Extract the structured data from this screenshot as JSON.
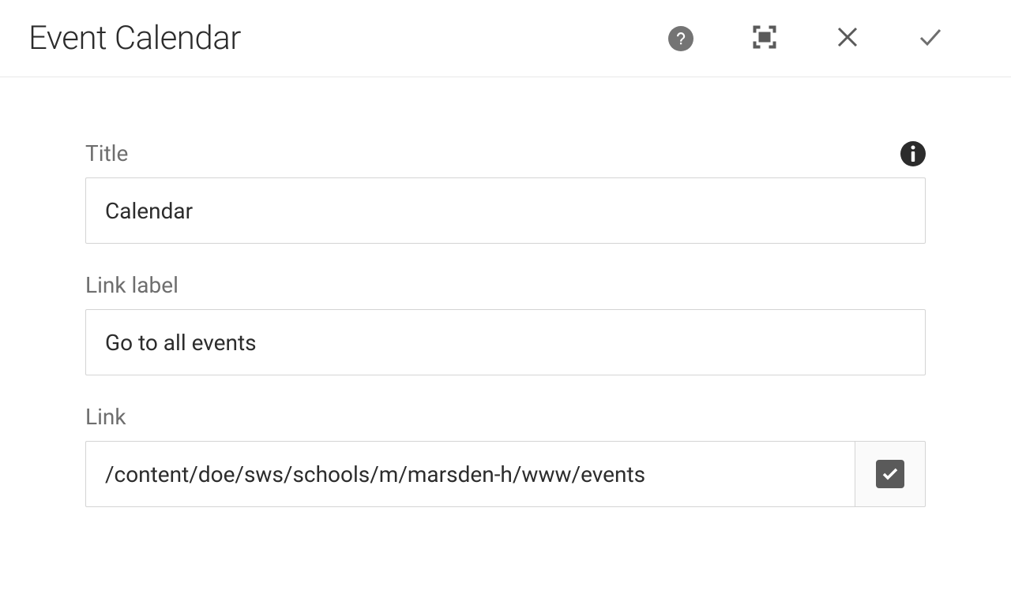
{
  "header": {
    "title": "Event Calendar"
  },
  "fields": {
    "title": {
      "label": "Title",
      "value": "Calendar"
    },
    "linkLabel": {
      "label": "Link label",
      "value": "Go to all events"
    },
    "link": {
      "label": "Link",
      "value": "/content/doe/sws/schools/m/marsden-h/www/events"
    }
  }
}
